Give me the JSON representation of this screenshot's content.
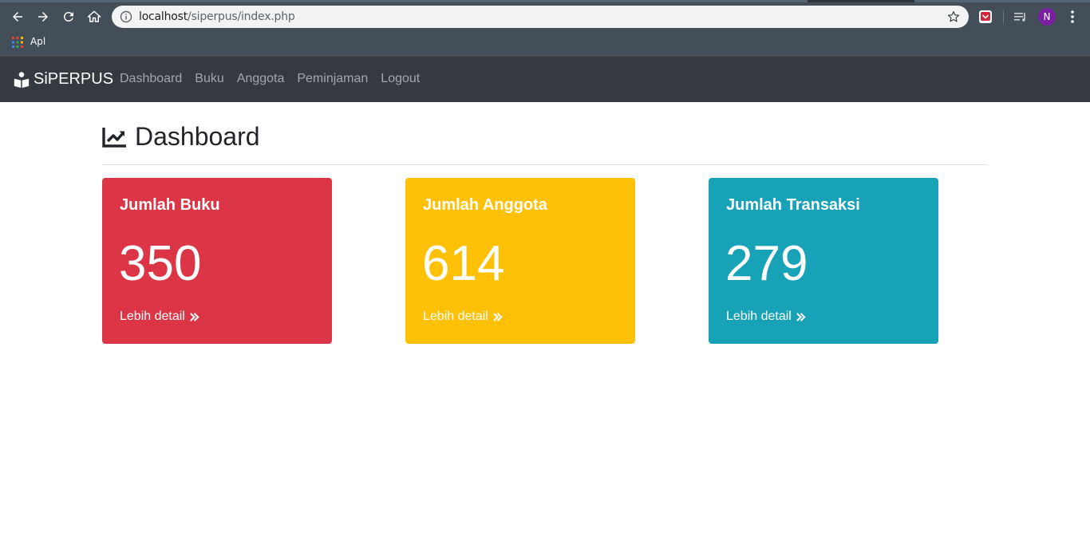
{
  "browser": {
    "url_host": "localhost",
    "url_path": "/siperpus/index.php",
    "bookmarks": [
      {
        "label": "Apl"
      }
    ],
    "profile_initial": "N"
  },
  "navbar": {
    "brand": "SiPERPUS",
    "links": [
      {
        "label": "Dashboard"
      },
      {
        "label": "Buku"
      },
      {
        "label": "Anggota"
      },
      {
        "label": "Peminjaman"
      },
      {
        "label": "Logout"
      }
    ]
  },
  "page": {
    "title": "Dashboard"
  },
  "cards": [
    {
      "title": "Jumlah Buku",
      "value": "350",
      "link": "Lebih detail",
      "color": "#dc3545"
    },
    {
      "title": "Jumlah Anggota",
      "value": "614",
      "link": "Lebih detail",
      "color": "#ffc107"
    },
    {
      "title": "Jumlah Transaksi",
      "value": "279",
      "link": "Lebih detail",
      "color": "#17a2b8"
    }
  ]
}
